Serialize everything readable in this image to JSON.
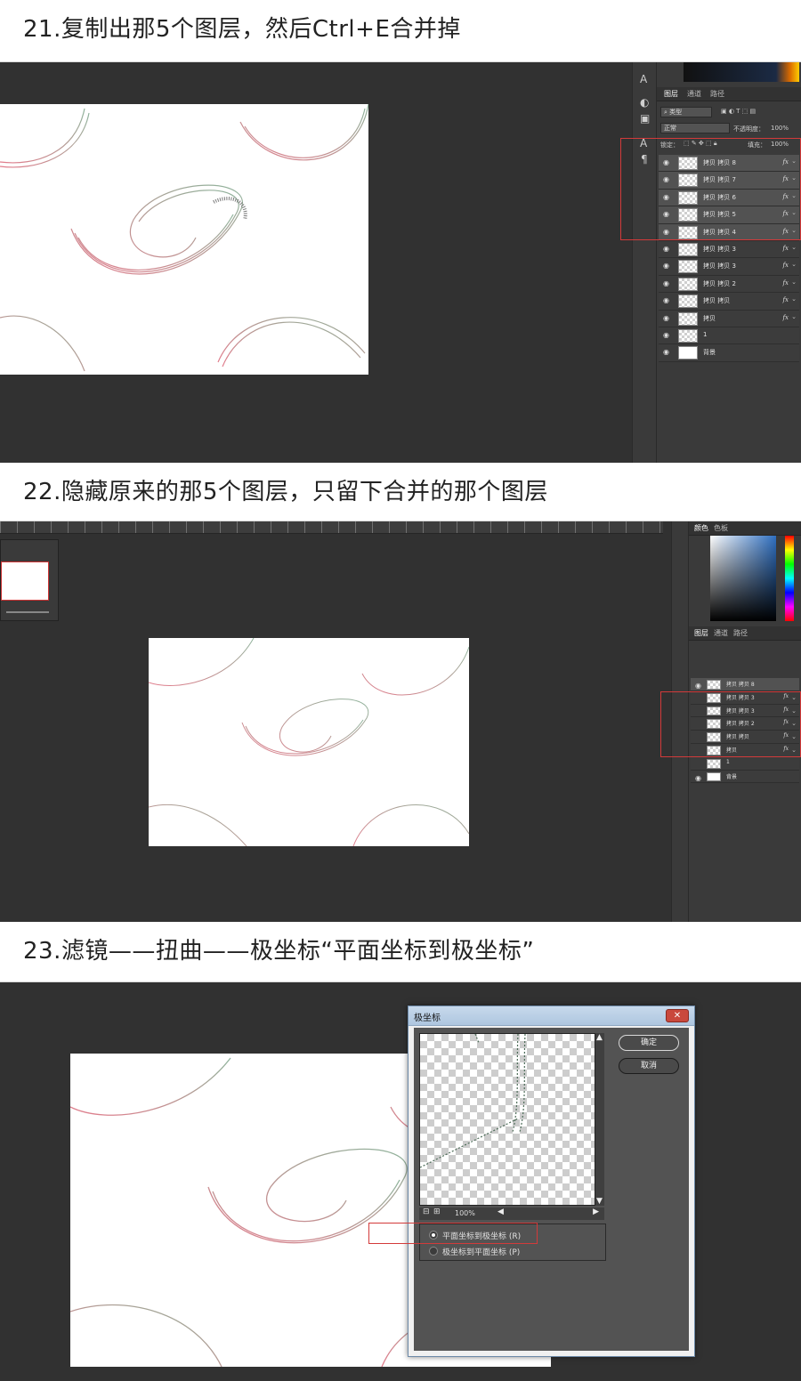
{
  "steps": [
    {
      "heading": "21.复制出那5个图层，然后Ctrl+E合并掉"
    },
    {
      "heading": "22.隐藏原来的那5个图层，只留下合并的那个图层"
    },
    {
      "heading": "23.滤镜——扭曲——极坐标“平面坐标到极坐标”"
    }
  ],
  "layers_panel": {
    "tabs": [
      "图层",
      "通道",
      "路径"
    ],
    "filter_kind": "类型",
    "blend_mode": "正常",
    "opacity_label": "不透明度：",
    "opacity_value": "100%",
    "lock_label": "锁定：",
    "fill_label": "填充：",
    "fill_value": "100%"
  },
  "step21_layers": [
    {
      "name": "拷贝 拷贝 8",
      "fx": "fx",
      "selected": true
    },
    {
      "name": "拷贝 拷贝 7",
      "fx": "fx",
      "selected": true
    },
    {
      "name": "拷贝 拷贝 6",
      "fx": "fx",
      "selected": true
    },
    {
      "name": "拷贝 拷贝 5",
      "fx": "fx",
      "selected": true
    },
    {
      "name": "拷贝 拷贝 4",
      "fx": "fx",
      "selected": true
    },
    {
      "name": "拷贝 拷贝 3",
      "fx": "fx",
      "selected": false
    },
    {
      "name": "拷贝 拷贝 3",
      "fx": "fx",
      "selected": false
    },
    {
      "name": "拷贝 拷贝 2",
      "fx": "fx",
      "selected": false
    },
    {
      "name": "拷贝 拷贝",
      "fx": "fx",
      "selected": false
    },
    {
      "name": "拷贝",
      "fx": "fx",
      "selected": false
    },
    {
      "name": "1",
      "fx": "",
      "selected": false
    },
    {
      "name": "背景",
      "fx": "",
      "selected": false
    }
  ],
  "step22_layers": [
    {
      "name": "拷贝 拷贝 8",
      "fx": "",
      "selected": true,
      "visible": true
    },
    {
      "name": "拷贝 拷贝 3",
      "fx": "fx",
      "selected": false,
      "visible": false
    },
    {
      "name": "拷贝 拷贝 3",
      "fx": "fx",
      "selected": false,
      "visible": false
    },
    {
      "name": "拷贝 拷贝 2",
      "fx": "fx",
      "selected": false,
      "visible": false
    },
    {
      "name": "拷贝 拷贝",
      "fx": "fx",
      "selected": false,
      "visible": false
    },
    {
      "name": "拷贝",
      "fx": "fx",
      "selected": false,
      "visible": false
    },
    {
      "name": "1",
      "fx": "",
      "selected": false,
      "visible": false
    },
    {
      "name": "背景",
      "fx": "",
      "selected": false,
      "visible": true
    }
  ],
  "color_panel": {
    "tabs": [
      "颜色",
      "色板"
    ]
  },
  "polar_dialog": {
    "title": "极坐标",
    "close_glyph": "✕",
    "ok_label": "确定",
    "cancel_label": "取消",
    "zoom_value": "100%",
    "options": [
      {
        "label": "平面坐标到极坐标 (R)",
        "checked": true
      },
      {
        "label": "极坐标到平面坐标 (P)",
        "checked": false
      }
    ]
  },
  "icons": {
    "eye": "eye-icon",
    "fx": "fx-icon",
    "close": "close-icon",
    "search": "search-icon"
  },
  "colors": {
    "swirl_pink": "#e27c8c",
    "swirl_green": "#8fb49c",
    "ps_dark": "#313131",
    "highlight_red": "#d33a3a"
  }
}
